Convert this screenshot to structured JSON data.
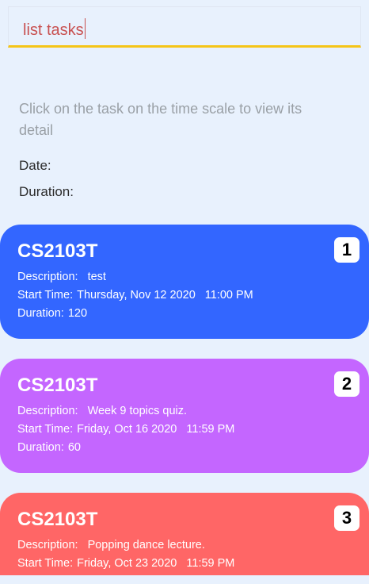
{
  "command": {
    "value": "list tasks"
  },
  "detail_panel": {
    "hint": "Click on the task on the time scale to view its detail",
    "date_label": "Date:",
    "duration_label": "Duration:"
  },
  "labels": {
    "description": "Description:",
    "start_time": "Start Time:",
    "duration": "Duration:"
  },
  "tasks": [
    {
      "index": "1",
      "title": "CS2103T",
      "description": "test",
      "start_date": "Thursday, Nov 12 2020",
      "start_time": "11:00 PM",
      "duration": "120",
      "color": "#3366ff"
    },
    {
      "index": "2",
      "title": "CS2103T",
      "description": "Week 9 topics quiz.",
      "start_date": "Friday, Oct 16 2020",
      "start_time": "11:59 PM",
      "duration": "60",
      "color": "#c466ff"
    },
    {
      "index": "3",
      "title": "CS2103T",
      "description": "Popping dance lecture.",
      "start_date": "Friday, Oct 23 2020",
      "start_time": "11:59 PM",
      "duration": "",
      "color": "#ff6666"
    }
  ]
}
